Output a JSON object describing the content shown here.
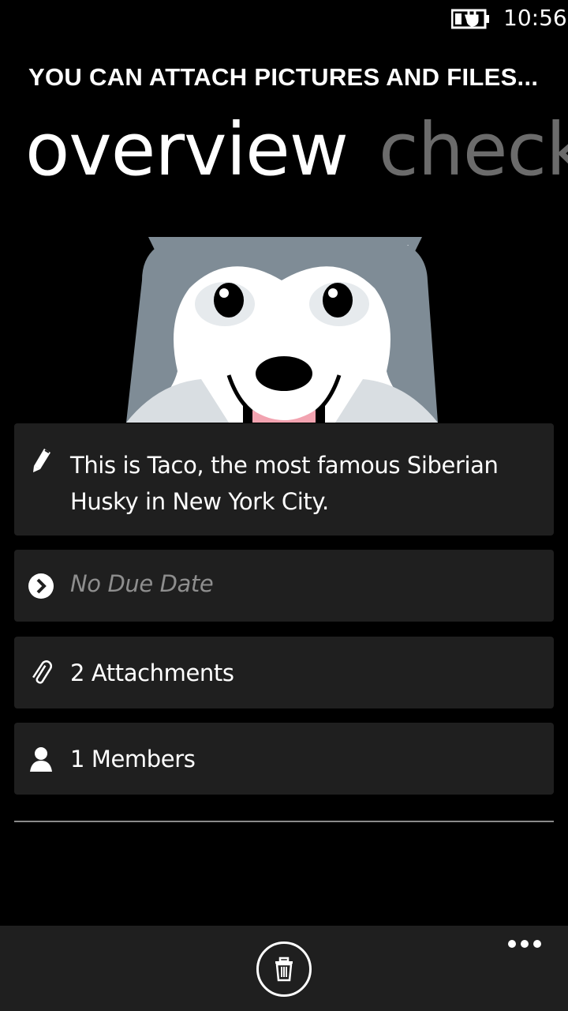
{
  "status_bar": {
    "time": "10:56"
  },
  "header": {
    "title": "YOU CAN ATTACH PICTURES AND FILES..."
  },
  "pivot": {
    "tabs": [
      {
        "label": "overview"
      },
      {
        "label": "check"
      }
    ]
  },
  "card": {
    "description": "This is Taco, the most famous Siberian Husky in New York City.",
    "due_date": "No Due Date",
    "attachments": "2 Attachments",
    "members": "1 Members"
  },
  "icons": {
    "description": "pencil-icon",
    "due_date": "chevron-circle-icon",
    "attachments": "paperclip-icon",
    "members": "person-icon",
    "delete": "trash-icon",
    "more": "more-dots-icon"
  },
  "colors": {
    "background": "#000000",
    "panel": "#1f1f1f",
    "inactive_tab": "#6b6b6b"
  }
}
